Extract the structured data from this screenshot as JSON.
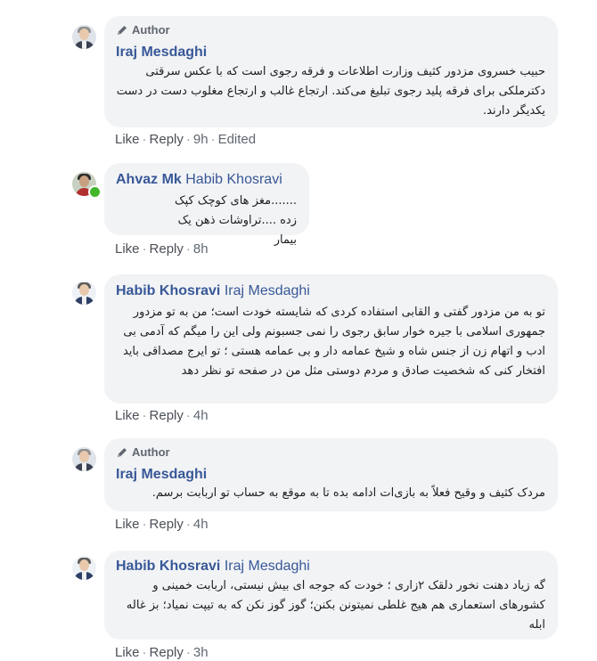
{
  "comments": [
    {
      "author_tag": "Author",
      "name": "Iraj Mesdaghi",
      "mention": "",
      "text": "حبیب خسروی مزدور کثیف وزارت اطلاعات و فرقه رجوی است که با عکس سرقتی دکترملکی برای فرقه پلید رجوی تبلیغ می‌کند. ارتجاع غالب و ارتجاع مغلوب دست در دست یکدیگر دارند.",
      "like": "Like",
      "reply": "Reply",
      "time": "9h",
      "edited": "Edited"
    },
    {
      "author_tag": "",
      "name": "Ahvaz Mk",
      "mention": "Habib Khosravi",
      "text": ".......مغز های کوچک کپک زده ....تراوشات ذهن یک بیمار",
      "like": "Like",
      "reply": "Reply",
      "time": "8h",
      "edited": ""
    },
    {
      "author_tag": "",
      "name": "Habib Khosravi",
      "mention": "Iraj Mesdaghi",
      "text": "تو به من مزدور گفتی و القابی استفاده کردی که شایسته خودت است؛ من به تو مزدور جمهوری اسلامی با جیره خوار سابق رجوی را نمی جسبونم ولی این را میگم که آدمی بی ادب و اتهام زن از جنس شاه و شیخ عمامه دار و بی عمامه هستی ؛ تو ایرج مصداقی باید افتخار کنی که شخصیت صادق و مردم دوستی مثل من در صفحه تو نظر دهد",
      "like": "Like",
      "reply": "Reply",
      "time": "4h",
      "edited": ""
    },
    {
      "author_tag": "Author",
      "name": "Iraj Mesdaghi",
      "mention": "",
      "text": "مردک کثیف و وقیح فعلاً به بازی‌ات ادامه بده تا به موقع به حساب تو اربابت برسم.",
      "like": "Like",
      "reply": "Reply",
      "time": "4h",
      "edited": ""
    },
    {
      "author_tag": "",
      "name": "Habib Khosravi",
      "mention": "Iraj Mesdaghi",
      "text": "گه زیاد دهنت نخور دلقک ۲زاری ؛ خودت که جوجه ای بیش نیستی، اربابت خمینی و کشورهای استعماری هم هیج غلطی نمیتونن بکنن؛ گوز گوز نکن که به تیپت نمیاد؛ بز غاله ابله",
      "like": "Like",
      "reply": "Reply",
      "time": "3h",
      "edited": ""
    }
  ]
}
